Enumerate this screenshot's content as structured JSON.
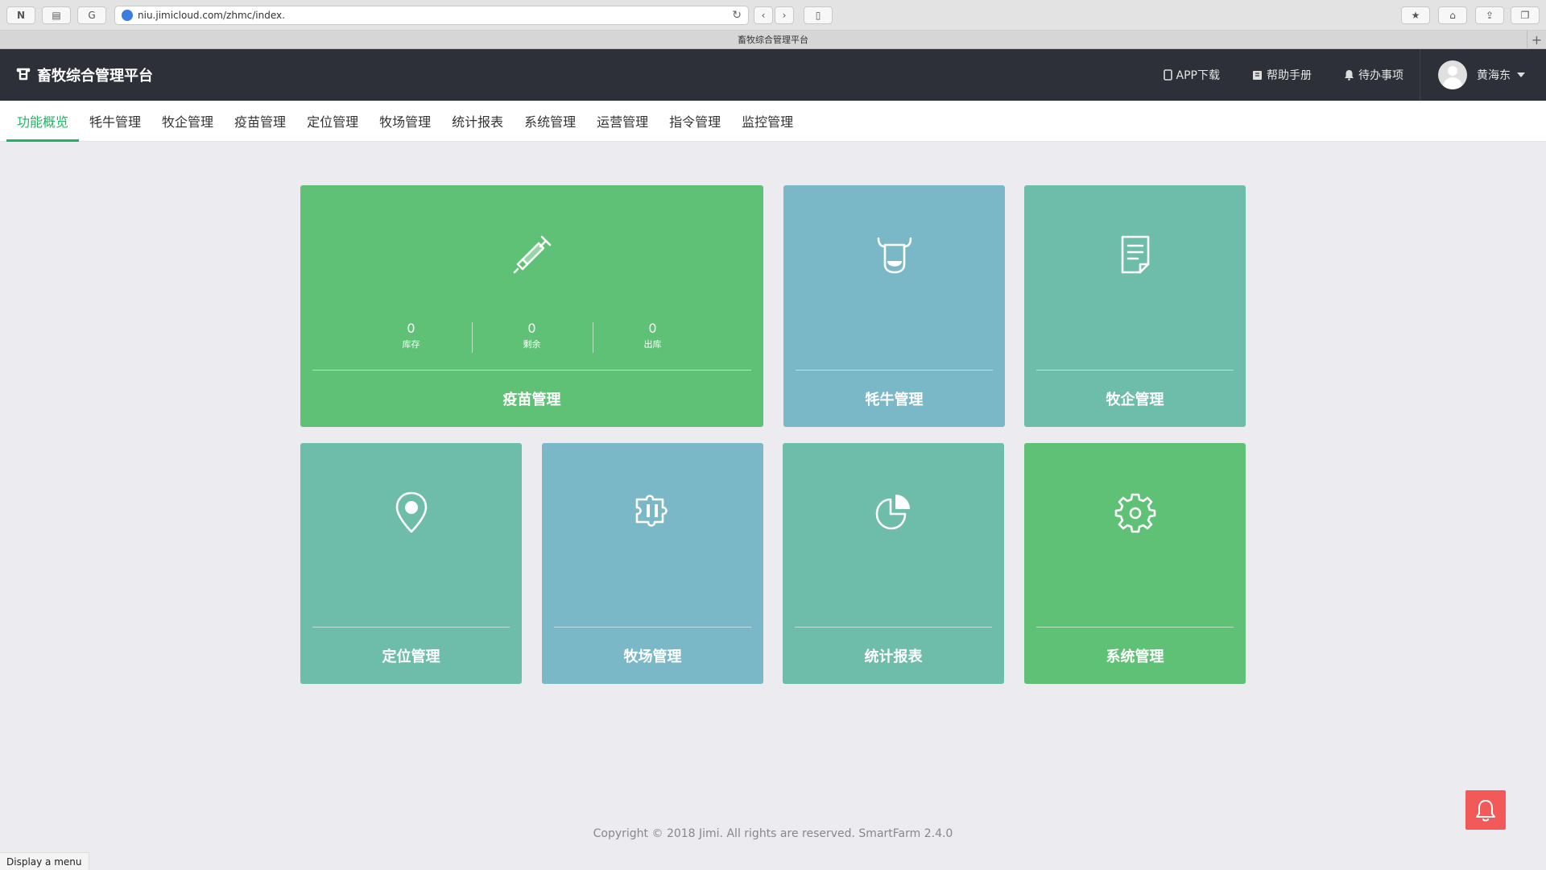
{
  "browser": {
    "url": "niu.jimicloud.com/zhmc/index.",
    "tab_title": "畜牧综合管理平台",
    "status_text": "Display a menu"
  },
  "header": {
    "brand": "畜牧综合管理平台",
    "app_download": "APP下载",
    "help_manual": "帮助手册",
    "todo": "待办事项",
    "user_name": "黄海东"
  },
  "nav": {
    "items": [
      {
        "label": "功能概览",
        "active": true
      },
      {
        "label": "牦牛管理"
      },
      {
        "label": "牧企管理"
      },
      {
        "label": "疫苗管理"
      },
      {
        "label": "定位管理"
      },
      {
        "label": "牧场管理"
      },
      {
        "label": "统计报表"
      },
      {
        "label": "系统管理"
      },
      {
        "label": "运营管理"
      },
      {
        "label": "指令管理"
      },
      {
        "label": "监控管理"
      }
    ]
  },
  "tiles": {
    "vaccine": {
      "label": "疫苗管理",
      "icon": "syringe-icon",
      "color": "#5fc176",
      "stats": [
        {
          "value": "0",
          "caption": "库存"
        },
        {
          "value": "0",
          "caption": "剩余"
        },
        {
          "value": "0",
          "caption": "出库"
        }
      ]
    },
    "yak": {
      "label": "牦牛管理",
      "icon": "yak-icon",
      "color": "#7ab8c8"
    },
    "enterprise": {
      "label": "牧企管理",
      "icon": "document-icon",
      "color": "#6ebdab"
    },
    "location": {
      "label": "定位管理",
      "icon": "location-pin-icon",
      "color": "#6ebdab"
    },
    "ranch": {
      "label": "牧场管理",
      "icon": "puzzle-icon",
      "color": "#7ab8c8"
    },
    "stats": {
      "label": "统计报表",
      "icon": "pie-chart-icon",
      "color": "#6ebdab"
    },
    "system": {
      "label": "系统管理",
      "icon": "gear-icon",
      "color": "#5fc176"
    }
  },
  "footer": {
    "copyright": "Copyright © 2018 Jimi. All rights are reserved. SmartFarm 2.4.0"
  },
  "colors": {
    "accent": "#1fb464",
    "header_bg": "#2d3039",
    "alert": "#f25a5a"
  }
}
